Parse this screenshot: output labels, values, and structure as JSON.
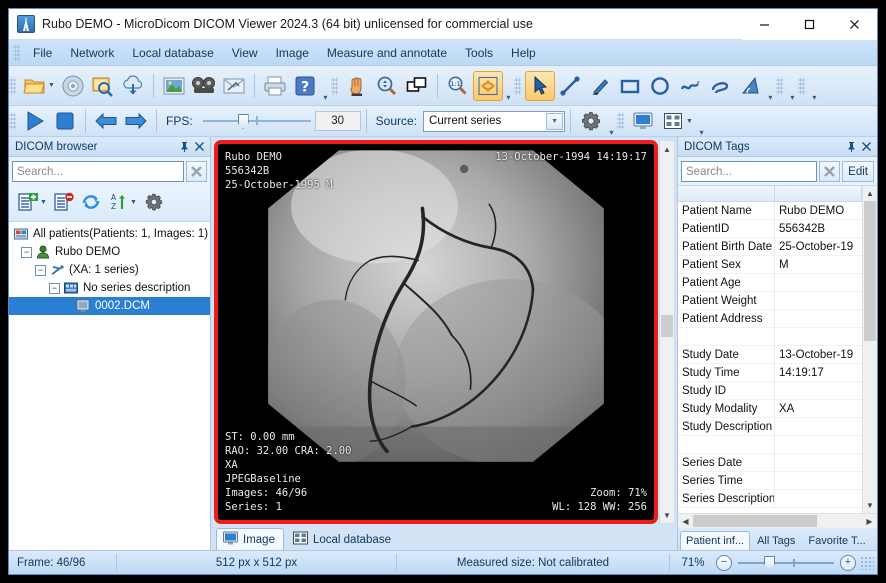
{
  "window": {
    "title": "Rubo DEMO - MicroDicom DICOM Viewer 2024.3 (64 bit) unlicensed for commercial use",
    "minimize_label": "Minimize",
    "maximize_label": "Maximize",
    "close_label": "Close"
  },
  "menu": {
    "items": [
      {
        "label": "File"
      },
      {
        "label": "Network"
      },
      {
        "label": "Local database"
      },
      {
        "label": "View"
      },
      {
        "label": "Image"
      },
      {
        "label": "Measure and annotate"
      },
      {
        "label": "Tools"
      },
      {
        "label": "Help"
      }
    ]
  },
  "toolbar_main": {
    "buttons": [
      {
        "name": "open-folder-icon"
      },
      {
        "name": "open-cd-icon"
      },
      {
        "name": "scan-search-icon"
      },
      {
        "name": "download-cloud-icon"
      },
      {
        "name": "export-image-icon"
      },
      {
        "name": "export-video-icon"
      },
      {
        "name": "send-email-icon"
      },
      {
        "name": "print-icon"
      },
      {
        "name": "help-icon"
      }
    ]
  },
  "toolbar_tools": {
    "buttons": [
      {
        "name": "pan-hand-icon"
      },
      {
        "name": "zoom-inout-icon"
      },
      {
        "name": "copy-window-icon"
      },
      {
        "name": "zoom-one-to-one-icon",
        "badge": "1:1"
      },
      {
        "name": "fit-to-window-icon",
        "active": true
      }
    ]
  },
  "toolbar_annotate": {
    "buttons": [
      {
        "name": "select-arrow-icon",
        "active": true
      },
      {
        "name": "measure-line-icon"
      },
      {
        "name": "freehand-pen-icon"
      },
      {
        "name": "rectangle-icon"
      },
      {
        "name": "ellipse-icon"
      },
      {
        "name": "polyline-icon"
      },
      {
        "name": "closed-curve-icon"
      },
      {
        "name": "angle-icon"
      }
    ]
  },
  "playback": {
    "play_label": "Play",
    "stop_label": "Stop",
    "prev_label": "Previous frame",
    "next_label": "Next frame",
    "fps_label": "FPS:",
    "fps_value": "30",
    "source_label": "Source:",
    "source_value": "Current series",
    "settings_label": "Settings",
    "layout_single_label": "Single view",
    "layout_grid_label": "Tile layout"
  },
  "left_panel": {
    "title": "DICOM browser",
    "pin_label": "Pin",
    "close_label": "Close",
    "search": {
      "placeholder": "Search...",
      "value": ""
    },
    "clear_label": "Clear search",
    "tools": [
      {
        "name": "add-files-icon"
      },
      {
        "name": "remove-files-icon"
      },
      {
        "name": "refresh-icon"
      },
      {
        "name": "sort-az-icon"
      },
      {
        "name": "browser-settings-icon"
      }
    ],
    "tree": [
      {
        "level": 0,
        "label": "All patients(Patients: 1, Images: 1)",
        "icon": "patients-root-icon",
        "expander": "",
        "selected": false
      },
      {
        "level": 1,
        "label": "Rubo DEMO",
        "icon": "patient-icon",
        "expander": "-",
        "selected": false
      },
      {
        "level": 2,
        "label": "(XA: 1 series)",
        "icon": "study-xa-icon",
        "expander": "-",
        "selected": false
      },
      {
        "level": 3,
        "label": "No series description",
        "icon": "series-icon",
        "expander": "-",
        "selected": false
      },
      {
        "level": 4,
        "label": "0002.DCM",
        "icon": "dicom-file-icon",
        "expander": "",
        "selected": true
      }
    ]
  },
  "viewer": {
    "overlay": {
      "top_left": "Rubo DEMO\n556342B\n25-October-1995 M",
      "top_right": "13-October-1994 14:19:17",
      "bottom_left": "ST: 0.00 mm\nRAO: 32.00 CRA: 2.00\nXA\nJPEGBaseline\nImages: 46/96\nSeries: 1",
      "bottom_right": "Zoom: 71%\nWL: 128 WW: 256"
    },
    "tabs": [
      {
        "label": "Image",
        "icon": "monitor-icon",
        "selected": true
      },
      {
        "label": "Local database",
        "icon": "grid-table-icon",
        "selected": false
      }
    ]
  },
  "right_panel": {
    "title": "DICOM Tags",
    "pin_label": "Pin",
    "close_label": "Close",
    "search": {
      "placeholder": "Search...",
      "value": ""
    },
    "clear_label": "Clear search",
    "edit_label": "Edit",
    "columns": [
      "",
      ""
    ],
    "rows": [
      {
        "key": "Patient Name",
        "value": "Rubo DEMO"
      },
      {
        "key": "PatientID",
        "value": "556342B"
      },
      {
        "key": "Patient Birth Date",
        "value": "25-October-19"
      },
      {
        "key": "Patient Sex",
        "value": "M"
      },
      {
        "key": "Patient Age",
        "value": ""
      },
      {
        "key": "Patient Weight",
        "value": ""
      },
      {
        "key": "Patient Address",
        "value": ""
      },
      {
        "key": "",
        "value": ""
      },
      {
        "key": "Study Date",
        "value": "13-October-19"
      },
      {
        "key": "Study Time",
        "value": "14:19:17"
      },
      {
        "key": "Study ID",
        "value": ""
      },
      {
        "key": "Study Modality",
        "value": "XA"
      },
      {
        "key": "Study Description",
        "value": ""
      },
      {
        "key": "",
        "value": ""
      },
      {
        "key": "Series Date",
        "value": ""
      },
      {
        "key": "Series Time",
        "value": ""
      },
      {
        "key": "Series Description",
        "value": ""
      }
    ],
    "tabs": [
      {
        "label": "Patient inf...",
        "selected": true
      },
      {
        "label": "All Tags",
        "selected": false
      },
      {
        "label": "Favorite T...",
        "selected": false
      }
    ]
  },
  "statusbar": {
    "frame": "Frame: 46/96",
    "dimensions": "512 px x 512 px",
    "measured": "Measured size: Not calibrated",
    "zoom": "71%",
    "zoom_out_label": "Zoom out",
    "zoom_in_label": "Zoom in"
  },
  "colors": {
    "accent": "#2a7fd4",
    "selection_frame": "#ef1c1c",
    "chrome": "#d6e6f7",
    "text": "#123a63"
  }
}
